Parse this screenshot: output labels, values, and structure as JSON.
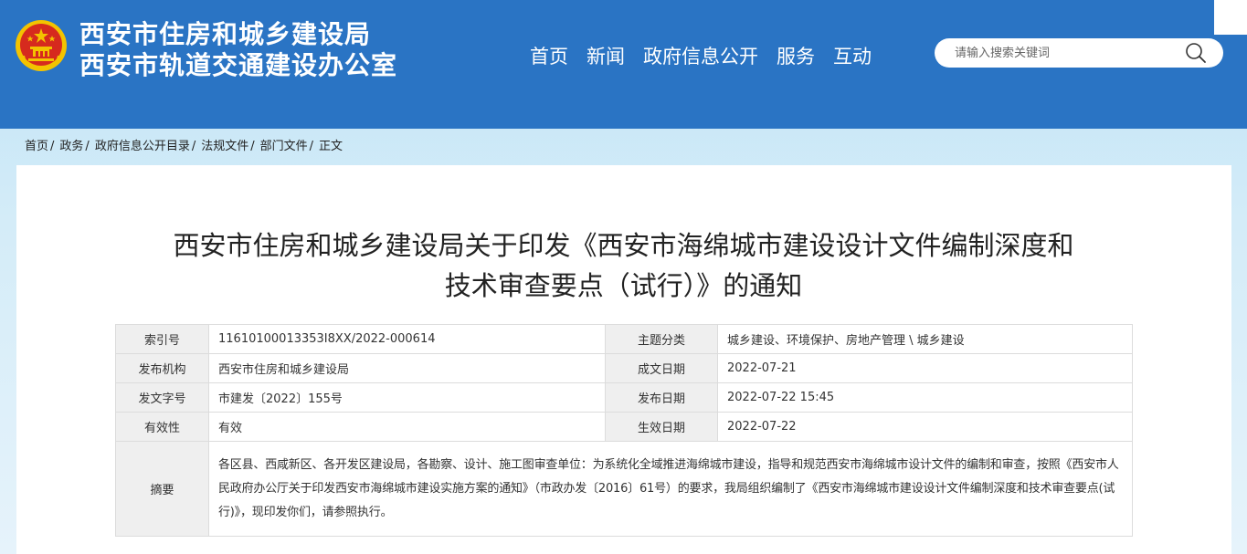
{
  "header": {
    "title_line1": "西安市住房和城乡建设局",
    "title_line2": "西安市轨道交通建设办公室",
    "nav": [
      "首页",
      "新闻",
      "政府信息公开",
      "服务",
      "互动"
    ],
    "search_placeholder": "请输入搜索关键词"
  },
  "breadcrumb": [
    "首页",
    "政务",
    "政府信息公开目录",
    "法规文件",
    "部门文件",
    "正文"
  ],
  "breadcrumb_sep": "/",
  "article": {
    "title_line1": "西安市住房和城乡建设局关于印发《西安市海绵城市建设设计文件编制深度和",
    "title_line2": "技术审查要点（试行）》的通知"
  },
  "meta": {
    "index_label": "索引号",
    "index_value": "11610100013353I8XX/2022-000614",
    "topic_label": "主题分类",
    "topic_value": "城乡建设、环境保护、房地产管理 \\ 城乡建设",
    "publisher_label": "发布机构",
    "publisher_value": "西安市住房和城乡建设局",
    "written_label": "成文日期",
    "written_value": "2022-07-21",
    "docno_label": "发文字号",
    "docno_value": "市建发〔2022〕155号",
    "published_label": "发布日期",
    "published_value": "2022-07-22 15:45",
    "validity_label": "有效性",
    "validity_value": "有效",
    "effective_label": "生效日期",
    "effective_value": "2022-07-22",
    "summary_label": "摘要",
    "summary_value": "各区县、西咸新区、各开发区建设局，各勘察、设计、施工图审查单位：为系统化全域推进海绵城市建设，指导和规范西安市海绵城市设计文件的编制和审查，按照《西安市人民政府办公厅关于印发西安市海绵城市建设实施方案的通知》（市政办发〔2016〕61号）的要求，我局组织编制了《西安市海绵城市建设设计文件编制深度和技术审查要点(试行)》，现印发你们，请参照执行。"
  },
  "colors": {
    "header_bg": "#2a74c4",
    "emblem_red": "#d62a1e",
    "emblem_gold": "#f3c300"
  }
}
